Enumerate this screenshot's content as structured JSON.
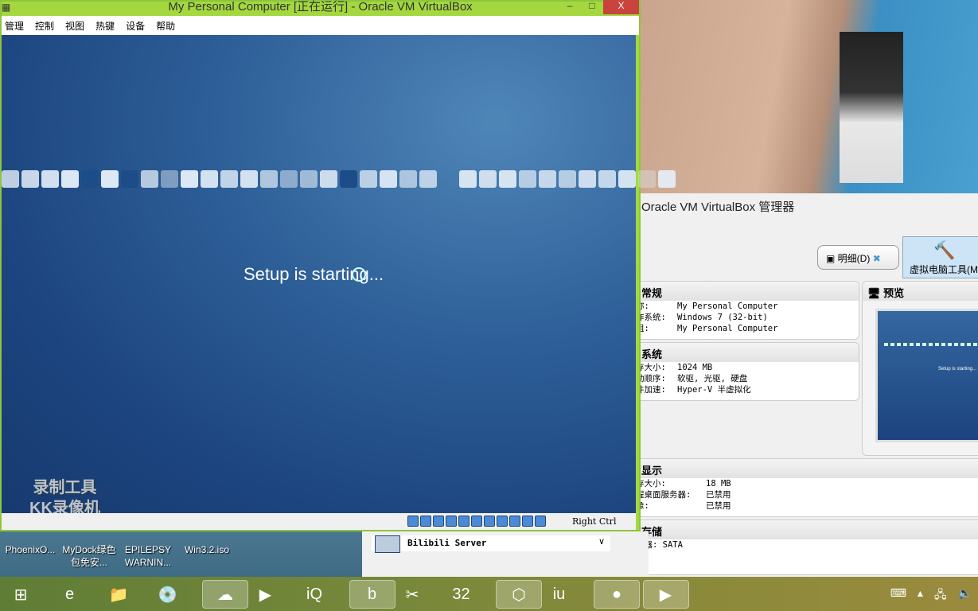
{
  "vm_window": {
    "title": "My Personal Computer [正在运行] - Oracle VM VirtualBox",
    "minimize": "–",
    "maximize": "□",
    "close": "X",
    "menu": [
      "管理",
      "控制",
      "视图",
      "热键",
      "设备",
      "帮助"
    ],
    "screen_text": "Setup is starting...",
    "status_host_key": "Right Ctrl"
  },
  "watermark": {
    "line1": "录制工具",
    "line2": "KK录像机"
  },
  "desktop_icons": [
    {
      "label": "PhoenixO..."
    },
    {
      "label": "MyDock绿色包免安..."
    },
    {
      "label": "EPILEPSY WARNIN..."
    },
    {
      "label": "Win3.2.iso"
    }
  ],
  "manager": {
    "title": "Oracle VM VirtualBox 管理器",
    "details_button": "明细(D)",
    "tools_button": "虚拟电脑工具(M",
    "vm_list_item": "Bilibili Server",
    "general": {
      "heading": "常规",
      "rows": [
        [
          "称:",
          "My Personal Computer"
        ],
        [
          "作系统:",
          "Windows 7 (32-bit)"
        ],
        [
          "组:",
          "My Personal Computer"
        ]
      ]
    },
    "system": {
      "heading": "系统",
      "rows": [
        [
          "存大小:",
          "1024 MB"
        ],
        [
          "动顺序:",
          "软驱, 光驱, 硬盘"
        ],
        [
          "件加速:",
          "Hyper-V 半虚拟化"
        ]
      ]
    },
    "preview": {
      "heading": "预览",
      "text": "Setup is starting..."
    },
    "display": {
      "heading": "显示",
      "rows": [
        [
          "存大小:",
          "18 MB"
        ],
        [
          "程桌面服务器:",
          "已禁用"
        ],
        [
          "像:",
          "已禁用"
        ]
      ]
    },
    "storage": {
      "heading": "存储",
      "rows": [
        [
          "制器: SATA",
          ""
        ]
      ]
    }
  },
  "taskbar": {
    "items": [
      "start",
      "internet-explorer",
      "file-explorer",
      "media-disc",
      "baidu-cloud",
      "video-player",
      "iqiyi",
      "bilibili",
      "scissors-tool",
      "dos-32",
      "virtualbox",
      "iu-app",
      "kk-recorder",
      "media-player"
    ],
    "tray": [
      "keyboard",
      "show-hidden",
      "network",
      "volume"
    ]
  }
}
